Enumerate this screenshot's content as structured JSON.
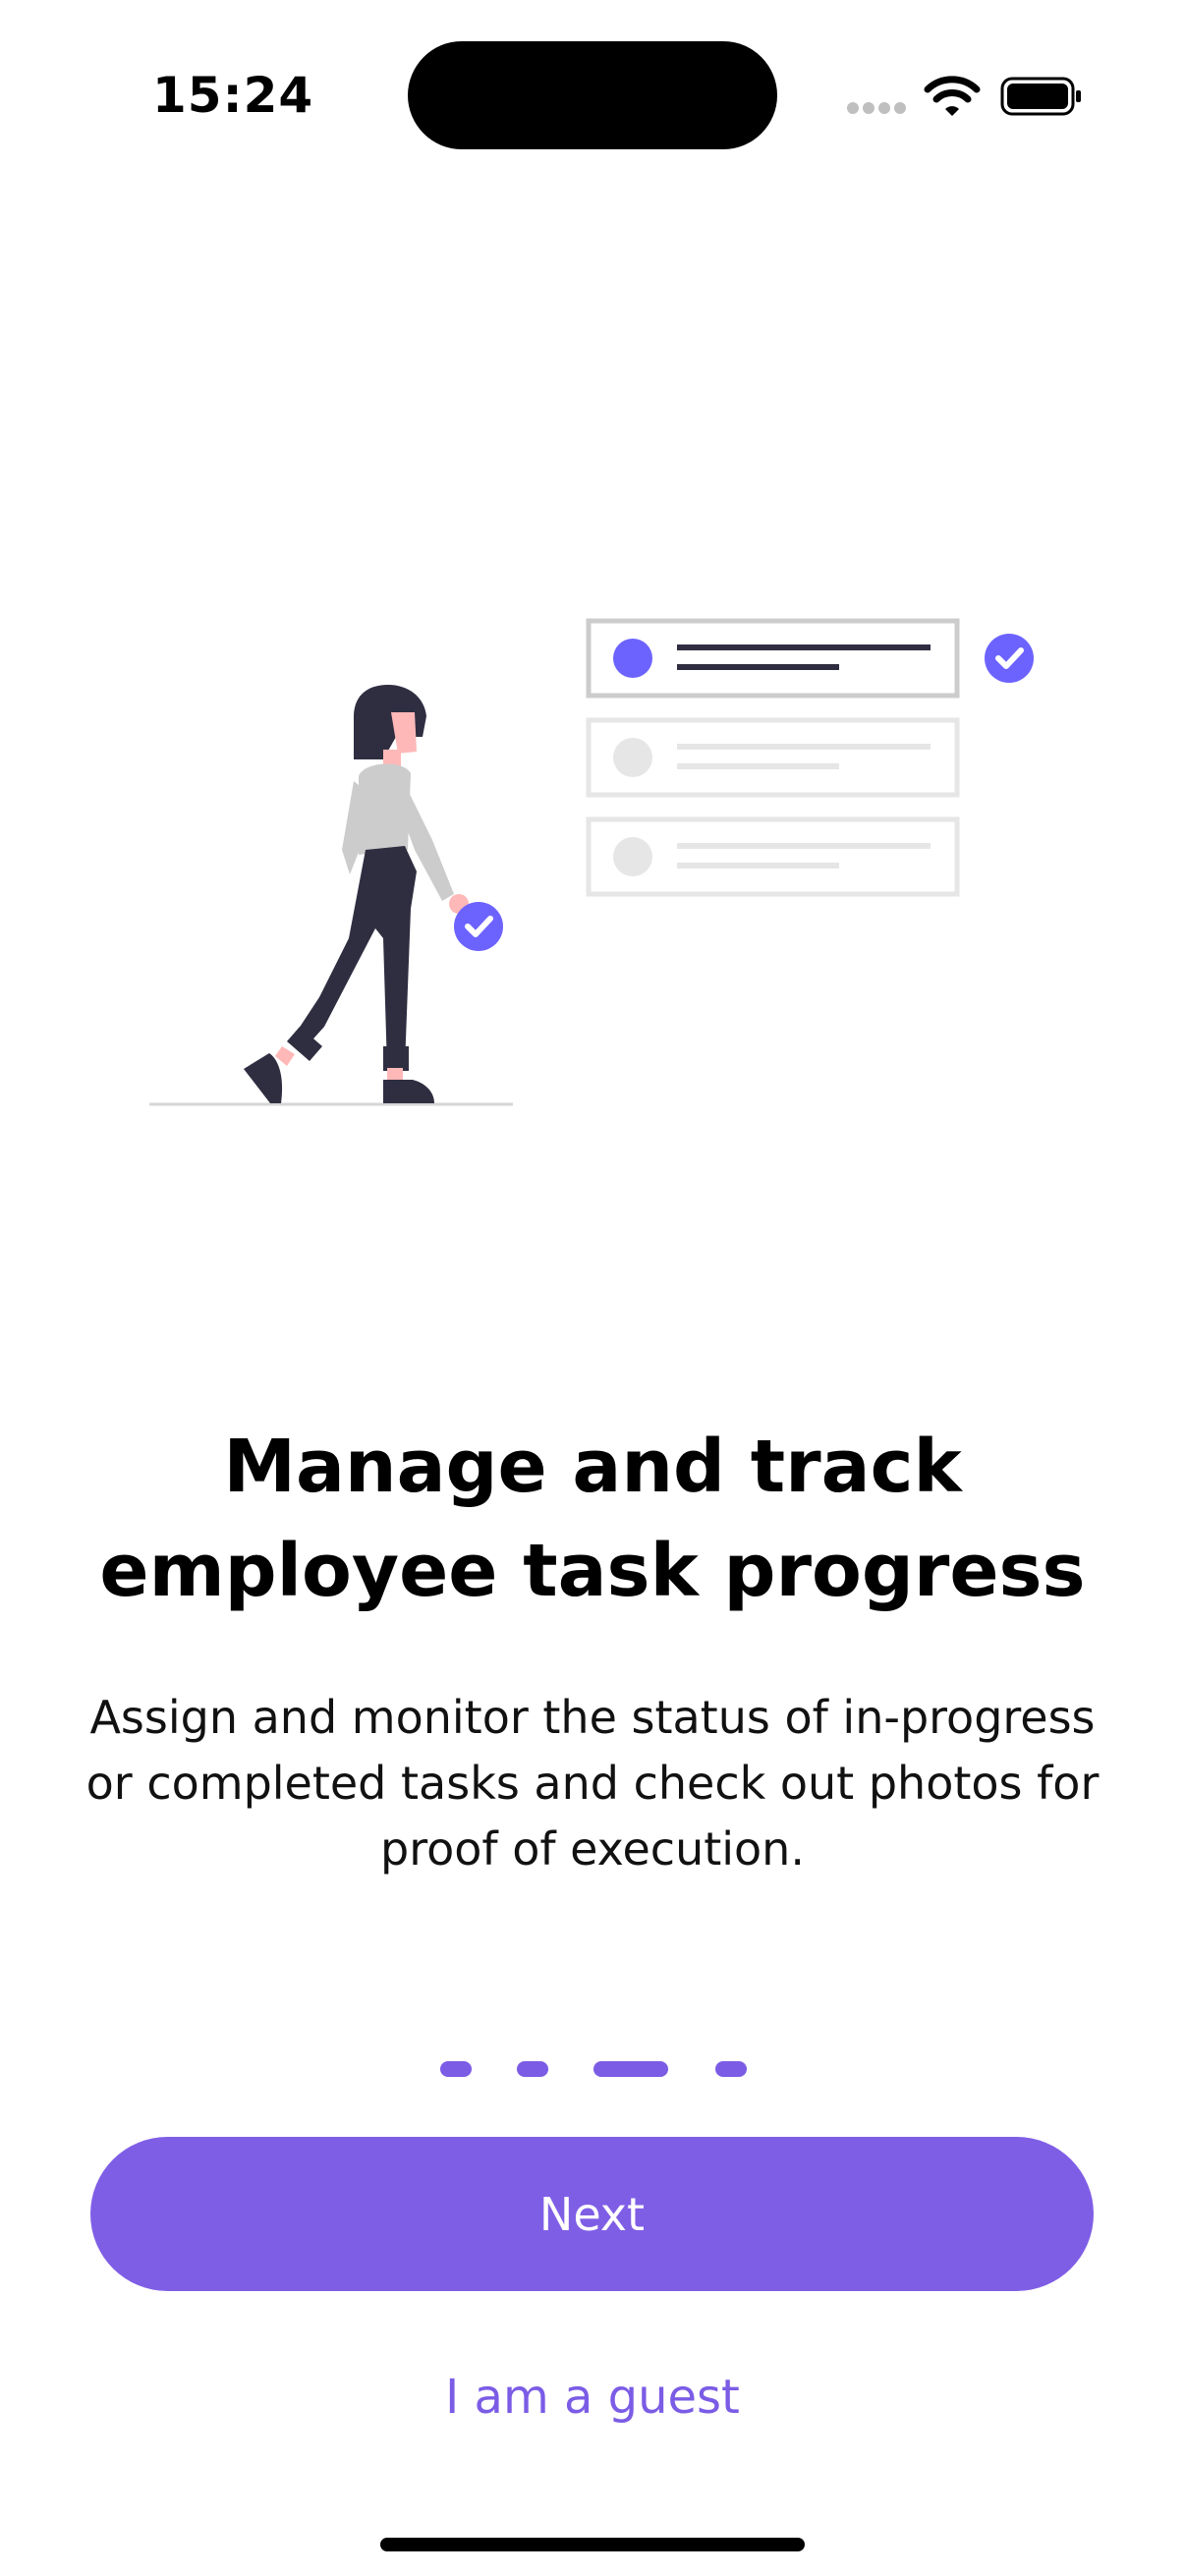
{
  "status_bar": {
    "time": "15:24"
  },
  "onboarding": {
    "title_line1": "Manage and track",
    "title_line2": "employee task progress",
    "description_line1": "Assign and monitor the status of in-progress",
    "description_line2": "or completed tasks and check out photos for",
    "description_line3": "proof of execution."
  },
  "page_indicator": {
    "total_pages": 4,
    "active_page": 3
  },
  "actions": {
    "next_label": "Next",
    "guest_label": "I am a guest"
  },
  "colors": {
    "accent": "#7f5ee6",
    "illustration_accent": "#6c63ff",
    "figure_dark": "#2f2e41",
    "figure_shirt": "#cccccc",
    "skin": "#ffb8b8",
    "card_inactive": "#e6e6e6"
  }
}
